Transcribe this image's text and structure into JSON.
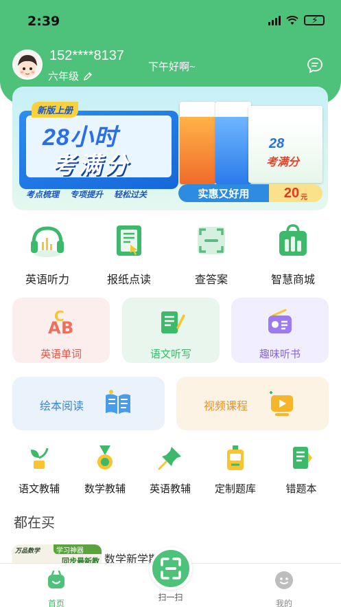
{
  "status_bar": {
    "time": "2:39"
  },
  "user": {
    "phone": "152****8137",
    "grade": "六年级",
    "greeting": "下午好啊~",
    "avatar_icon": "boy-avatar",
    "edit_icon": "pencil-icon",
    "message_icon": "chat-bubble-icon"
  },
  "banner": {
    "tag": "新版上册",
    "headline_1": "28小时",
    "headline_2": "考满分",
    "subs": [
      "考点梳理",
      "专项提升",
      "轻松过关"
    ],
    "price_label": "实惠又好用",
    "price_value": "20",
    "price_unit": "元"
  },
  "main_nav": [
    {
      "label": "英语听力",
      "icon": "headphones-icon"
    },
    {
      "label": "报纸点读",
      "icon": "newspaper-touch-icon"
    },
    {
      "label": "查答案",
      "icon": "scan-answer-icon"
    },
    {
      "label": "智慧商城",
      "icon": "shopping-bag-icon"
    }
  ],
  "feature_cards": [
    {
      "label": "英语单词",
      "icon": "abc-letters-icon",
      "bg": "#fdeeee",
      "color": "#e8564a"
    },
    {
      "label": "语文听写",
      "icon": "notebook-pen-icon",
      "bg": "#e8f6ee",
      "color": "#3cb96a"
    },
    {
      "label": "趣味听书",
      "icon": "radio-icon",
      "bg": "#f1efff",
      "color": "#8a63e8"
    }
  ],
  "wide_cards": [
    {
      "label": "绘本阅读",
      "icon": "open-book-icon",
      "bg": "#eaf2fc",
      "color": "#3b85d8"
    },
    {
      "label": "视频课程",
      "icon": "video-play-icon",
      "bg": "#fdf3e5",
      "color": "#e8922a"
    }
  ],
  "small_nav": [
    {
      "label": "语文教辅",
      "icon": "sprout-icon"
    },
    {
      "label": "数学教辅",
      "icon": "medal-icon"
    },
    {
      "label": "英语教辅",
      "icon": "pushpin-icon"
    },
    {
      "label": "定制题库",
      "icon": "badge-id-icon"
    },
    {
      "label": "错题本",
      "icon": "notebook-icon"
    }
  ],
  "section_title": "都在买",
  "product": {
    "name": "数学新学期   报纸",
    "thumb_brand": "万品数学",
    "thumb_tag": "学习神器",
    "thumb_caption": "同步最新教"
  },
  "tabbar": {
    "home": "首页",
    "scan": "扫一扫",
    "mine": "我的"
  },
  "colors": {
    "brand_green": "#4ec27a",
    "accent_green": "#3cb96a"
  }
}
